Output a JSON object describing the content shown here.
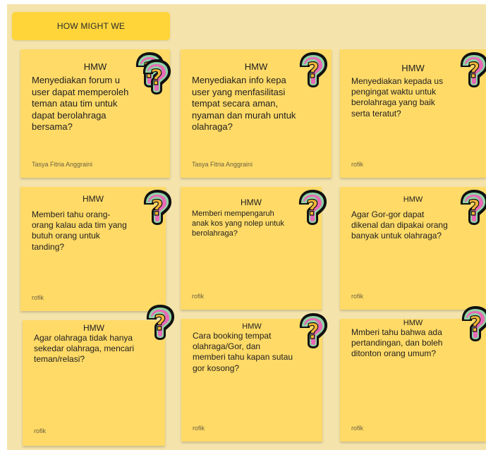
{
  "board": {
    "header_label": "HOW MIGHT WE",
    "sticker_icon": "question-mark-sticker",
    "colors": {
      "board_bg": "#f4e3ab",
      "header_bg": "#ffd53a",
      "note_bg": "#ffda67",
      "sticker_outer": "#111111",
      "sticker_mid": "#8fd3a6",
      "sticker_inner": "#e86ab5",
      "sticker_glyph": "#f3b73a"
    }
  },
  "notes": [
    {
      "title": "HMW",
      "lines": [
        "Menyediakan forum u",
        "user dapat memperoleh",
        "teman atau tim untuk",
        "dapat berolahraga",
        "bersama?"
      ],
      "author": "Tasya Fitria Anggraini"
    },
    {
      "title": "HMW",
      "lines": [
        "Menyediakan info kepa",
        "user yang menfasilitasi",
        "tempat secara aman,",
        "nyaman dan murah untuk",
        "olahraga?"
      ],
      "author": "Tasya Fitria Anggraini"
    },
    {
      "title": "HMW",
      "lines": [
        "Menyediakan kepada us",
        "pengingat waktu untuk",
        "berolahraga yang baik",
        "serta teratut?"
      ],
      "author": "rofik"
    },
    {
      "title": "HMW",
      "lines": [
        "Memberi tahu orang-",
        "orang kalau ada tim yang",
        "butuh orang untuk",
        "tanding?"
      ],
      "author": "rofik"
    },
    {
      "title": "HMW",
      "lines": [
        "Memberi mempengaruh",
        "anak kos yang nolep untuk",
        "berolahraga?"
      ],
      "author": "rofik"
    },
    {
      "title": "HMW",
      "lines": [
        "Agar Gor-gor dapat",
        "dikenal dan dipakai orang",
        "banyak untuk olahraga?"
      ],
      "author": "rofik"
    },
    {
      "title": "HMW",
      "lines": [
        "Agar olahraga tidak hanya",
        "sekedar olahraga, mencari",
        "teman/relasi?"
      ],
      "author": "rofik"
    },
    {
      "title": "HMW",
      "lines": [
        "Cara booking tempat",
        "olahraga/Gor, dan",
        "memberi tahu kapan sutau",
        "gor kosong?"
      ],
      "author": "rofik"
    },
    {
      "title": "HMW",
      "lines": [
        "Mmberi tahu bahwa ada",
        "pertandingan, dan boleh",
        "ditonton orang umum?"
      ],
      "author": "rofik"
    }
  ]
}
